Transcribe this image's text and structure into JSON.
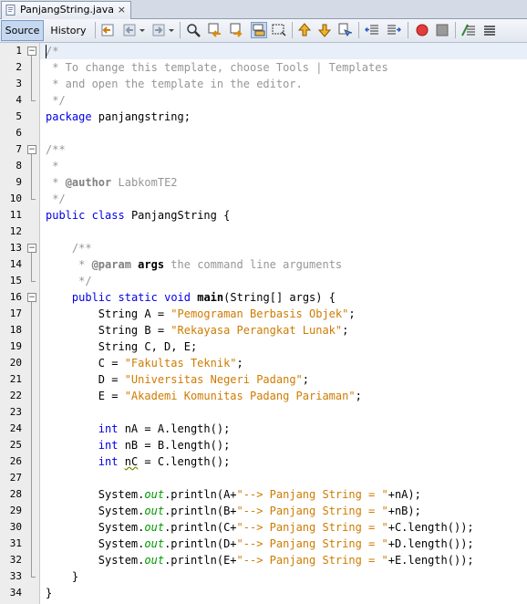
{
  "tab": {
    "title": "PanjangString.java",
    "close": "×"
  },
  "toolbar": {
    "source_label": "Source",
    "history_label": "History"
  },
  "editor": {
    "line_numbers": [
      "1",
      "2",
      "3",
      "4",
      "5",
      "6",
      "7",
      "8",
      "9",
      "10",
      "11",
      "12",
      "13",
      "14",
      "15",
      "16",
      "17",
      "18",
      "19",
      "20",
      "21",
      "22",
      "23",
      "24",
      "25",
      "26",
      "27",
      "28",
      "29",
      "30",
      "31",
      "32",
      "33",
      "34"
    ],
    "lines": [
      [
        {
          "t": "/*",
          "c": "cm"
        }
      ],
      [
        {
          "t": " * To change this template, choose Tools | Templates",
          "c": "cm"
        }
      ],
      [
        {
          "t": " * and open the template in the editor.",
          "c": "cm"
        }
      ],
      [
        {
          "t": " */",
          "c": "cm"
        }
      ],
      [
        {
          "t": "package",
          "c": "kw"
        },
        {
          "t": " panjangstring;",
          "c": ""
        }
      ],
      [],
      [
        {
          "t": "/**",
          "c": "cm"
        }
      ],
      [
        {
          "t": " *",
          "c": "cm"
        }
      ],
      [
        {
          "t": " * ",
          "c": "cm"
        },
        {
          "t": "@author",
          "c": "tg"
        },
        {
          "t": " LabkomTE2",
          "c": "cm"
        }
      ],
      [
        {
          "t": " */",
          "c": "cm"
        }
      ],
      [
        {
          "t": "public",
          "c": "kw"
        },
        {
          "t": " ",
          "c": ""
        },
        {
          "t": "class",
          "c": "kw"
        },
        {
          "t": " PanjangString {",
          "c": ""
        }
      ],
      [],
      [
        {
          "t": "    /**",
          "c": "cm"
        }
      ],
      [
        {
          "t": "     * ",
          "c": "cm"
        },
        {
          "t": "@param",
          "c": "tg"
        },
        {
          "t": " ",
          "c": "cm"
        },
        {
          "t": "args",
          "c": "mb"
        },
        {
          "t": " the command line arguments",
          "c": "cm"
        }
      ],
      [
        {
          "t": "     */",
          "c": "cm"
        }
      ],
      [
        {
          "t": "    ",
          "c": ""
        },
        {
          "t": "public",
          "c": "kw"
        },
        {
          "t": " ",
          "c": ""
        },
        {
          "t": "static",
          "c": "kw"
        },
        {
          "t": " ",
          "c": ""
        },
        {
          "t": "void",
          "c": "kw"
        },
        {
          "t": " ",
          "c": ""
        },
        {
          "t": "main",
          "c": "mb"
        },
        {
          "t": "(String[] args) {",
          "c": ""
        }
      ],
      [
        {
          "t": "        String A = ",
          "c": ""
        },
        {
          "t": "\"Pemograman Berbasis Objek\"",
          "c": "st"
        },
        {
          "t": ";",
          "c": ""
        }
      ],
      [
        {
          "t": "        String B = ",
          "c": ""
        },
        {
          "t": "\"Rekayasa Perangkat Lunak\"",
          "c": "st"
        },
        {
          "t": ";",
          "c": ""
        }
      ],
      [
        {
          "t": "        String C, D, E;",
          "c": ""
        }
      ],
      [
        {
          "t": "        C = ",
          "c": ""
        },
        {
          "t": "\"Fakultas Teknik\"",
          "c": "st"
        },
        {
          "t": ";",
          "c": ""
        }
      ],
      [
        {
          "t": "        D = ",
          "c": ""
        },
        {
          "t": "\"Universitas Negeri Padang\"",
          "c": "st"
        },
        {
          "t": ";",
          "c": ""
        }
      ],
      [
        {
          "t": "        E = ",
          "c": ""
        },
        {
          "t": "\"Akademi Komunitas Padang Pariaman\"",
          "c": "st"
        },
        {
          "t": ";",
          "c": ""
        }
      ],
      [],
      [
        {
          "t": "        ",
          "c": ""
        },
        {
          "t": "int",
          "c": "kw"
        },
        {
          "t": " nA = A.length();",
          "c": ""
        }
      ],
      [
        {
          "t": "        ",
          "c": ""
        },
        {
          "t": "int",
          "c": "kw"
        },
        {
          "t": " nB = B.length();",
          "c": ""
        }
      ],
      [
        {
          "t": "        ",
          "c": ""
        },
        {
          "t": "int",
          "c": "kw"
        },
        {
          "t": " ",
          "c": ""
        },
        {
          "t": "nC",
          "c": "squig"
        },
        {
          "t": " = C.length();",
          "c": ""
        }
      ],
      [],
      [
        {
          "t": "        System.",
          "c": ""
        },
        {
          "t": "out",
          "c": "fd"
        },
        {
          "t": ".println(A+",
          "c": ""
        },
        {
          "t": "\"--> Panjang String = \"",
          "c": "st"
        },
        {
          "t": "+nA);",
          "c": ""
        }
      ],
      [
        {
          "t": "        System.",
          "c": ""
        },
        {
          "t": "out",
          "c": "fd"
        },
        {
          "t": ".println(B+",
          "c": ""
        },
        {
          "t": "\"--> Panjang String = \"",
          "c": "st"
        },
        {
          "t": "+nB);",
          "c": ""
        }
      ],
      [
        {
          "t": "        System.",
          "c": ""
        },
        {
          "t": "out",
          "c": "fd"
        },
        {
          "t": ".println(C+",
          "c": ""
        },
        {
          "t": "\"--> Panjang String = \"",
          "c": "st"
        },
        {
          "t": "+C.length());",
          "c": ""
        }
      ],
      [
        {
          "t": "        System.",
          "c": ""
        },
        {
          "t": "out",
          "c": "fd"
        },
        {
          "t": ".println(D+",
          "c": ""
        },
        {
          "t": "\"--> Panjang String = \"",
          "c": "st"
        },
        {
          "t": "+D.length());",
          "c": ""
        }
      ],
      [
        {
          "t": "        System.",
          "c": ""
        },
        {
          "t": "out",
          "c": "fd"
        },
        {
          "t": ".println(E+",
          "c": ""
        },
        {
          "t": "\"--> Panjang String = \"",
          "c": "st"
        },
        {
          "t": "+E.length());",
          "c": ""
        }
      ],
      [
        {
          "t": "    }",
          "c": ""
        }
      ],
      [
        {
          "t": "}",
          "c": ""
        }
      ]
    ]
  },
  "colors": {
    "keyword": "#0000e6",
    "string": "#ce7b00",
    "comment": "#969696",
    "field": "#009900"
  }
}
